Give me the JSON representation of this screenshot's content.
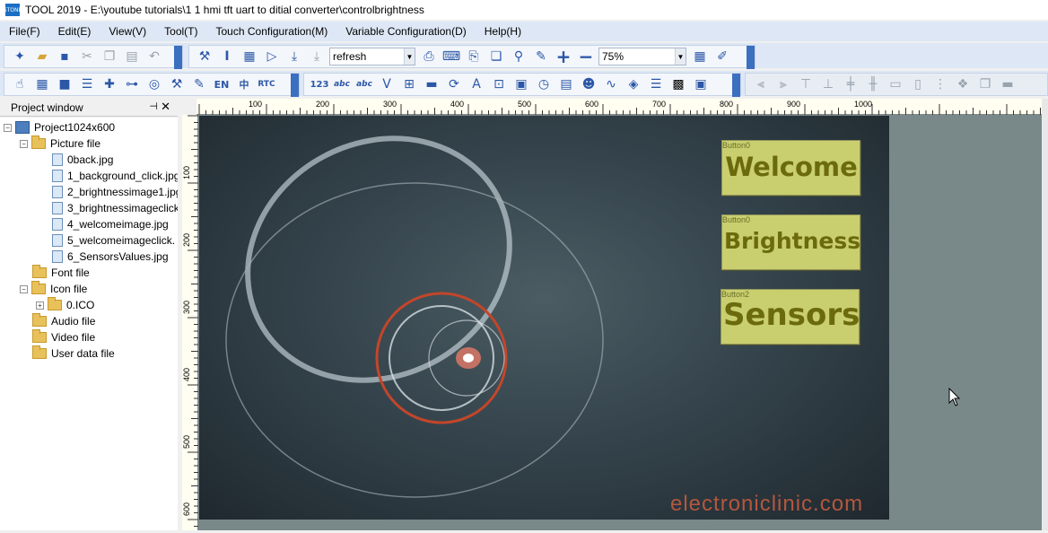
{
  "window": {
    "title": "TOOL 2019 - E:\\youtube tutorials\\1 1 hmi tft uart to ditial converter\\controlbrightness",
    "app_icon": "stone-logo-icon"
  },
  "menu": [
    "File(F)",
    "Edit(E)",
    "View(V)",
    "Tool(T)",
    "Touch Configuration(M)",
    "Variable Configuration(D)",
    "Help(H)"
  ],
  "toolbar": {
    "refresh_select": "refresh",
    "zoom_select": "75%",
    "lang_en": "EN",
    "lang_zh": "中",
    "rtc": "RTC",
    "num": "123",
    "abc1": "abc",
    "abc2": "abc"
  },
  "project_window": {
    "title": "Project window",
    "root": "Project1024x600",
    "picture_folder": "Picture file",
    "pictures": [
      "0back.jpg",
      "1_background_click.jpg",
      "2_brightnessimage1.jpg",
      "3_brightnessimageclick",
      "4_welcomeimage.jpg",
      "5_welcomeimageclick.",
      "6_SensorsValues.jpg"
    ],
    "font_folder": "Font file",
    "icon_folder": "Icon file",
    "icon_items": [
      "0.ICO"
    ],
    "audio_folder": "Audio file",
    "video_folder": "Video file",
    "userdata_folder": "User data file"
  },
  "ruler": {
    "top_labels": [
      "100",
      "200",
      "300",
      "400",
      "500",
      "600",
      "700",
      "800",
      "900",
      "1000"
    ],
    "left_labels": [
      "100",
      "200",
      "300",
      "400",
      "500",
      "600"
    ]
  },
  "screen": {
    "buttons": [
      {
        "caption": "Button0",
        "label": "Welcome"
      },
      {
        "caption": "Button0",
        "label": "Brightness"
      },
      {
        "caption": "Button2",
        "label": "Sensors"
      }
    ],
    "watermark": "electroniclinic.com"
  }
}
